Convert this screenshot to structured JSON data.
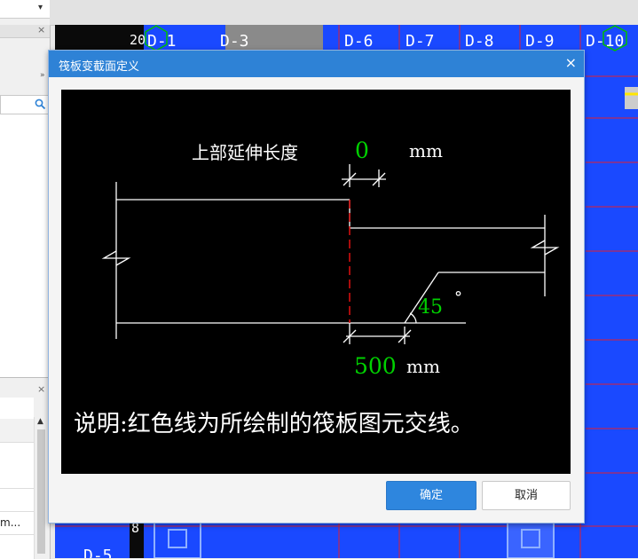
{
  "left_top_panel": {
    "close": "×",
    "arrows": "»"
  },
  "left_bottom_panel": {
    "close": "×",
    "list_item_text": "m..."
  },
  "cad": {
    "top_labels": [
      "D-1",
      "D-3",
      "D-6",
      "D-7",
      "D-8",
      "D-9",
      "D-10"
    ],
    "side_numbers": [
      "20",
      "8"
    ],
    "bottom_label": "D-5"
  },
  "dialog": {
    "title": "筏板变截面定义",
    "close": "×",
    "ok_label": "确定",
    "cancel_label": "取消",
    "diagram": {
      "top_extension_label": "上部延伸长度",
      "top_extension_value": "0",
      "top_unit": "mm",
      "angle_value": "45",
      "angle_unit": "°",
      "bottom_value": "500",
      "bottom_unit": "mm",
      "note": "说明:红色线为所绘制的筏板图元交线。"
    }
  },
  "colors": {
    "titlebar": "#2e82d6",
    "value_green": "#00d100",
    "red_line": "#e01010",
    "cad_blue": "#1a49ff"
  }
}
